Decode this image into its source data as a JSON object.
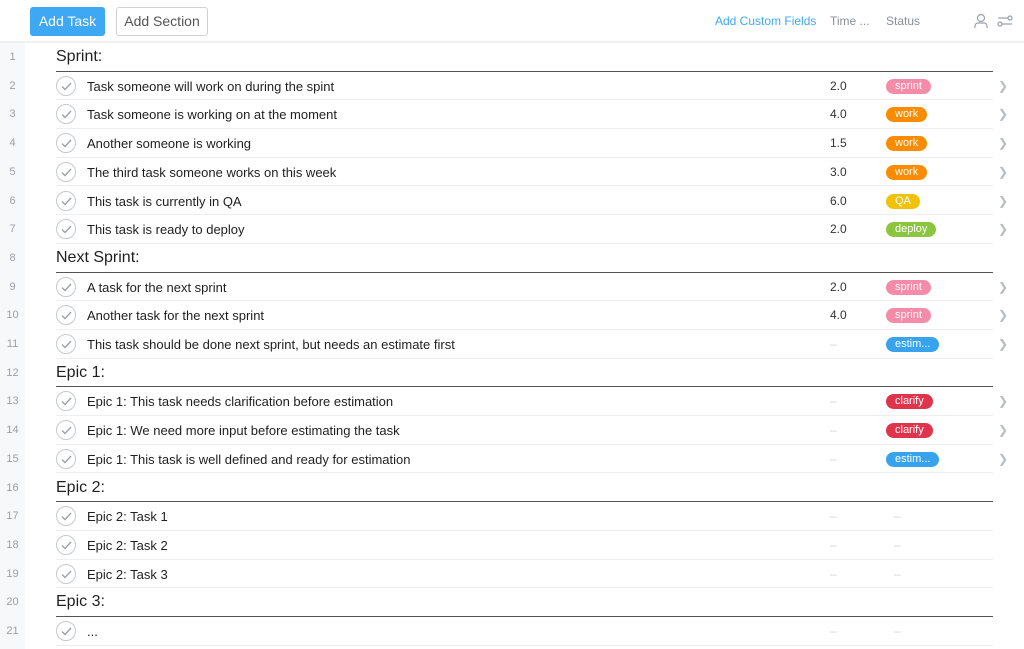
{
  "toolbar": {
    "add_task_label": "Add Task",
    "add_section_label": "Add Section",
    "add_custom_fields_label": "Add Custom Fields",
    "columns": {
      "time": "Time ...",
      "status": "Status"
    },
    "icons": [
      "user-icon",
      "filter-icon"
    ],
    "accent_color": "#3ea8f5"
  },
  "status_colors": {
    "sprint": "#f48ca9",
    "work": "#fb8c00",
    "QA": "#f0c20a",
    "deploy": "#8cc63f",
    "estim...": "#36a3ec",
    "clarify": "#e0334c"
  },
  "rows": [
    {
      "line": "1",
      "type": "section",
      "title": "Sprint:"
    },
    {
      "line": "2",
      "type": "task",
      "name": "Task someone will work on during the spint",
      "time": "2.0",
      "status": "sprint",
      "status_color": "#f48ca9",
      "chevron": true
    },
    {
      "line": "3",
      "type": "task",
      "name": "Task someone is working on at the moment",
      "time": "4.0",
      "status": "work",
      "status_color": "#fb8c00",
      "chevron": true
    },
    {
      "line": "4",
      "type": "task",
      "name": "Another someone is working",
      "time": "1.5",
      "status": "work",
      "status_color": "#fb8c00",
      "chevron": true
    },
    {
      "line": "5",
      "type": "task",
      "name": "The third task someone works on this week",
      "time": "3.0",
      "status": "work",
      "status_color": "#fb8c00",
      "chevron": true
    },
    {
      "line": "6",
      "type": "task",
      "name": "This task is currently in QA",
      "time": "6.0",
      "status": "QA",
      "status_color": "#f0c20a",
      "chevron": true
    },
    {
      "line": "7",
      "type": "task",
      "name": "This task is ready to deploy",
      "time": "2.0",
      "status": "deploy",
      "status_color": "#8cc63f",
      "chevron": true
    },
    {
      "line": "8",
      "type": "section",
      "title": "Next Sprint:"
    },
    {
      "line": "9",
      "type": "task",
      "name": "A task for the next sprint",
      "time": "2.0",
      "status": "sprint",
      "status_color": "#f48ca9",
      "chevron": true
    },
    {
      "line": "10",
      "type": "task",
      "name": "Another task for the next sprint",
      "time": "4.0",
      "status": "sprint",
      "status_color": "#f48ca9",
      "chevron": true
    },
    {
      "line": "11",
      "type": "task",
      "name": "This task should be done next sprint, but needs an estimate first",
      "time": "–",
      "status": "estim...",
      "status_color": "#36a3ec",
      "chevron": true
    },
    {
      "line": "12",
      "type": "section",
      "title": "Epic 1:"
    },
    {
      "line": "13",
      "type": "task",
      "name": "Epic 1: This task needs clarification before estimation",
      "time": "–",
      "status": "clarify",
      "status_color": "#e0334c",
      "chevron": true
    },
    {
      "line": "14",
      "type": "task",
      "name": "Epic 1: We need more input before estimating the task",
      "time": "–",
      "status": "clarify",
      "status_color": "#e0334c",
      "chevron": true
    },
    {
      "line": "15",
      "type": "task",
      "name": "Epic 1: This task is well defined and ready for estimation",
      "time": "–",
      "status": "estim...",
      "status_color": "#36a3ec",
      "chevron": true
    },
    {
      "line": "16",
      "type": "section",
      "title": "Epic 2:"
    },
    {
      "line": "17",
      "type": "task",
      "name": "Epic 2: Task 1",
      "time": "–",
      "status": "–",
      "status_color": null,
      "chevron": false
    },
    {
      "line": "18",
      "type": "task",
      "name": "Epic 2: Task 2",
      "time": "–",
      "status": "–",
      "status_color": null,
      "chevron": false
    },
    {
      "line": "19",
      "type": "task",
      "name": "Epic 2: Task 3",
      "time": "–",
      "status": "–",
      "status_color": null,
      "chevron": false
    },
    {
      "line": "20",
      "type": "section",
      "title": "Epic 3:"
    },
    {
      "line": "21",
      "type": "task",
      "name": "...",
      "time": "–",
      "status": "–",
      "status_color": null,
      "chevron": false
    }
  ]
}
